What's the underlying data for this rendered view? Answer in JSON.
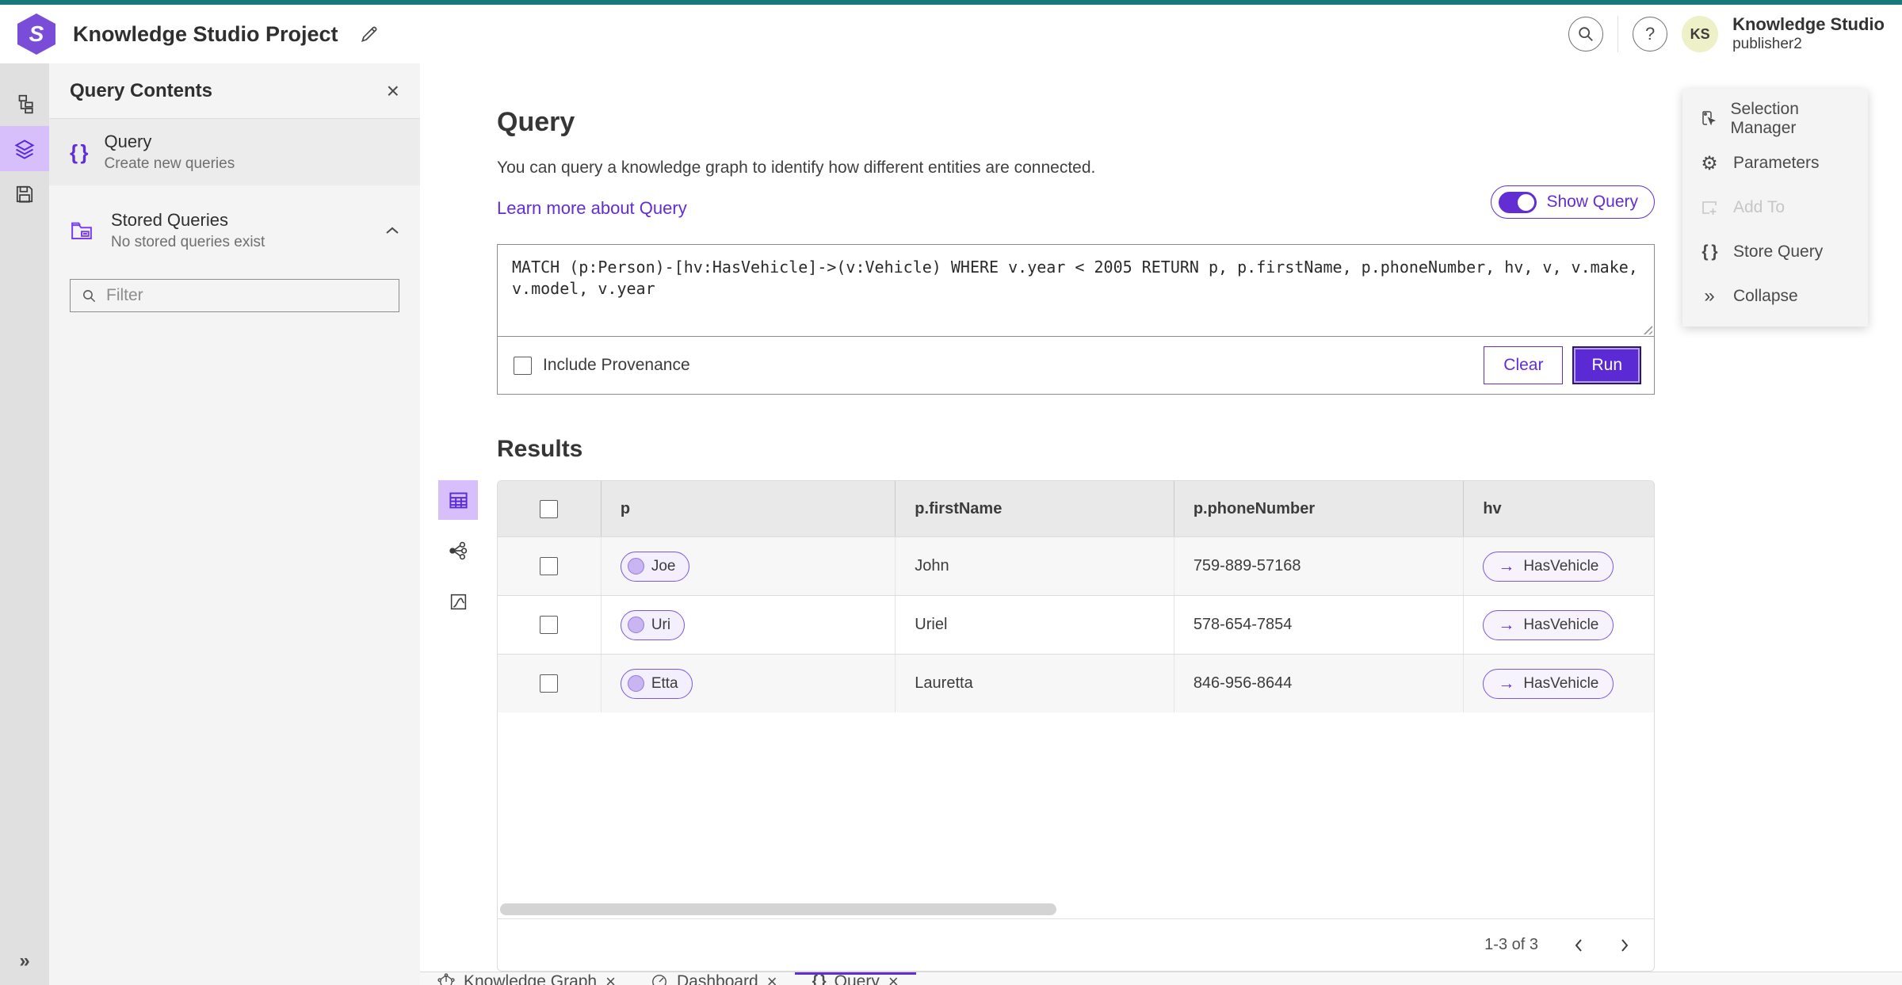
{
  "topbar": {
    "title": "Knowledge Studio Project",
    "user": {
      "initials": "KS",
      "name": "Knowledge Studio",
      "role": "publisher2"
    }
  },
  "icons": {
    "close": "×",
    "braces": "{ }",
    "collapse": "»",
    "gear": "⚙",
    "arrow_right": "→",
    "help": "?"
  },
  "left_panel": {
    "title": "Query Contents",
    "query_item": {
      "title": "Query",
      "subtitle": "Create new queries"
    },
    "stored_item": {
      "title": "Stored Queries",
      "subtitle": "No stored queries exist"
    },
    "filter_placeholder": "Filter"
  },
  "query": {
    "heading": "Query",
    "description": "You can query a knowledge graph to identify how different entities are connected.",
    "learn_more": "Learn more about Query",
    "show_query": "Show Query",
    "text": "MATCH (p:Person)-[hv:HasVehicle]->(v:Vehicle) WHERE v.year < 2005 RETURN p, p.firstName, p.phoneNumber, hv, v, v.make, v.model, v.year",
    "include_provenance": "Include Provenance",
    "clear": "Clear",
    "run": "Run"
  },
  "results": {
    "heading": "Results",
    "columns": [
      "p",
      "p.firstName",
      "p.phoneNumber",
      "hv"
    ],
    "rows": [
      {
        "p": "Joe",
        "firstName": "John",
        "phoneNumber": "759-889-57168",
        "hv": "HasVehicle"
      },
      {
        "p": "Uri",
        "firstName": "Uriel",
        "phoneNumber": "578-654-7854",
        "hv": "HasVehicle"
      },
      {
        "p": "Etta",
        "firstName": "Lauretta",
        "phoneNumber": "846-956-8644",
        "hv": "HasVehicle"
      }
    ],
    "pagination": "1-3 of 3"
  },
  "right_menu": {
    "items": [
      {
        "label": "Selection Manager"
      },
      {
        "label": "Parameters"
      },
      {
        "label": "Add To"
      },
      {
        "label": "Store Query"
      },
      {
        "label": "Collapse"
      }
    ]
  },
  "tabs": [
    {
      "label": "Knowledge Graph"
    },
    {
      "label": "Dashboard"
    },
    {
      "label": "Query"
    }
  ],
  "colors": {
    "accent": "#632dd4",
    "accent_dark": "#5b2ad5",
    "teal": "#18787c",
    "selected_bg": "#d6bffa"
  }
}
